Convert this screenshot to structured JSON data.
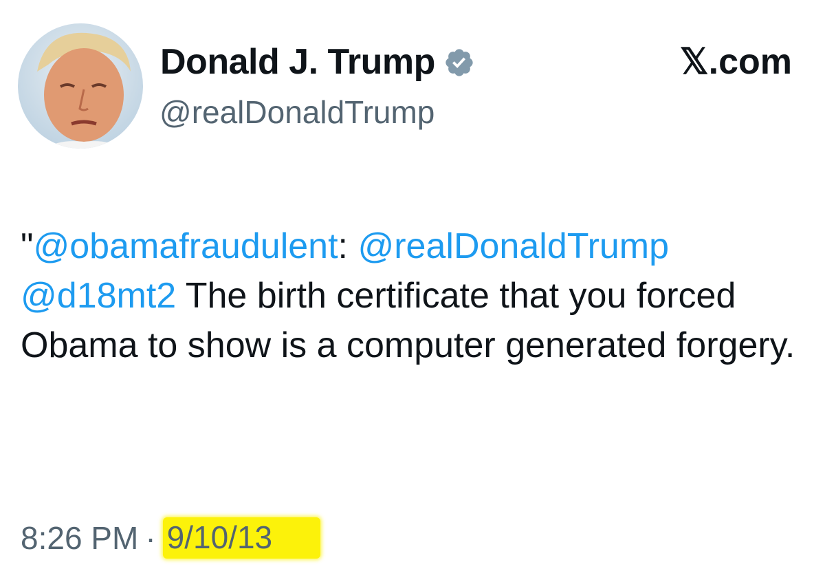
{
  "author": {
    "name": "Donald J. Trump",
    "handle": "@realDonaldTrump",
    "verified_icon": "verified-badge-icon",
    "avatar": "profile-photo"
  },
  "site": "𝕏.com",
  "tweet": {
    "quote_open": "\"",
    "mention_1": "@obamafraudulent",
    "colon": ":",
    "mention_2": "@realDonaldTrump",
    "mention_3": "@d18mt2",
    "body": "The birth certificate that you forced Obama to show is a computer generated forgery."
  },
  "meta": {
    "time": "8:26 PM",
    "separator": "·",
    "date": "9/10/13",
    "highlight_color": "#fcf20a"
  },
  "colors": {
    "mention": "#1d9bf0",
    "secondary_text": "#536471",
    "primary_text": "#0f1419"
  }
}
